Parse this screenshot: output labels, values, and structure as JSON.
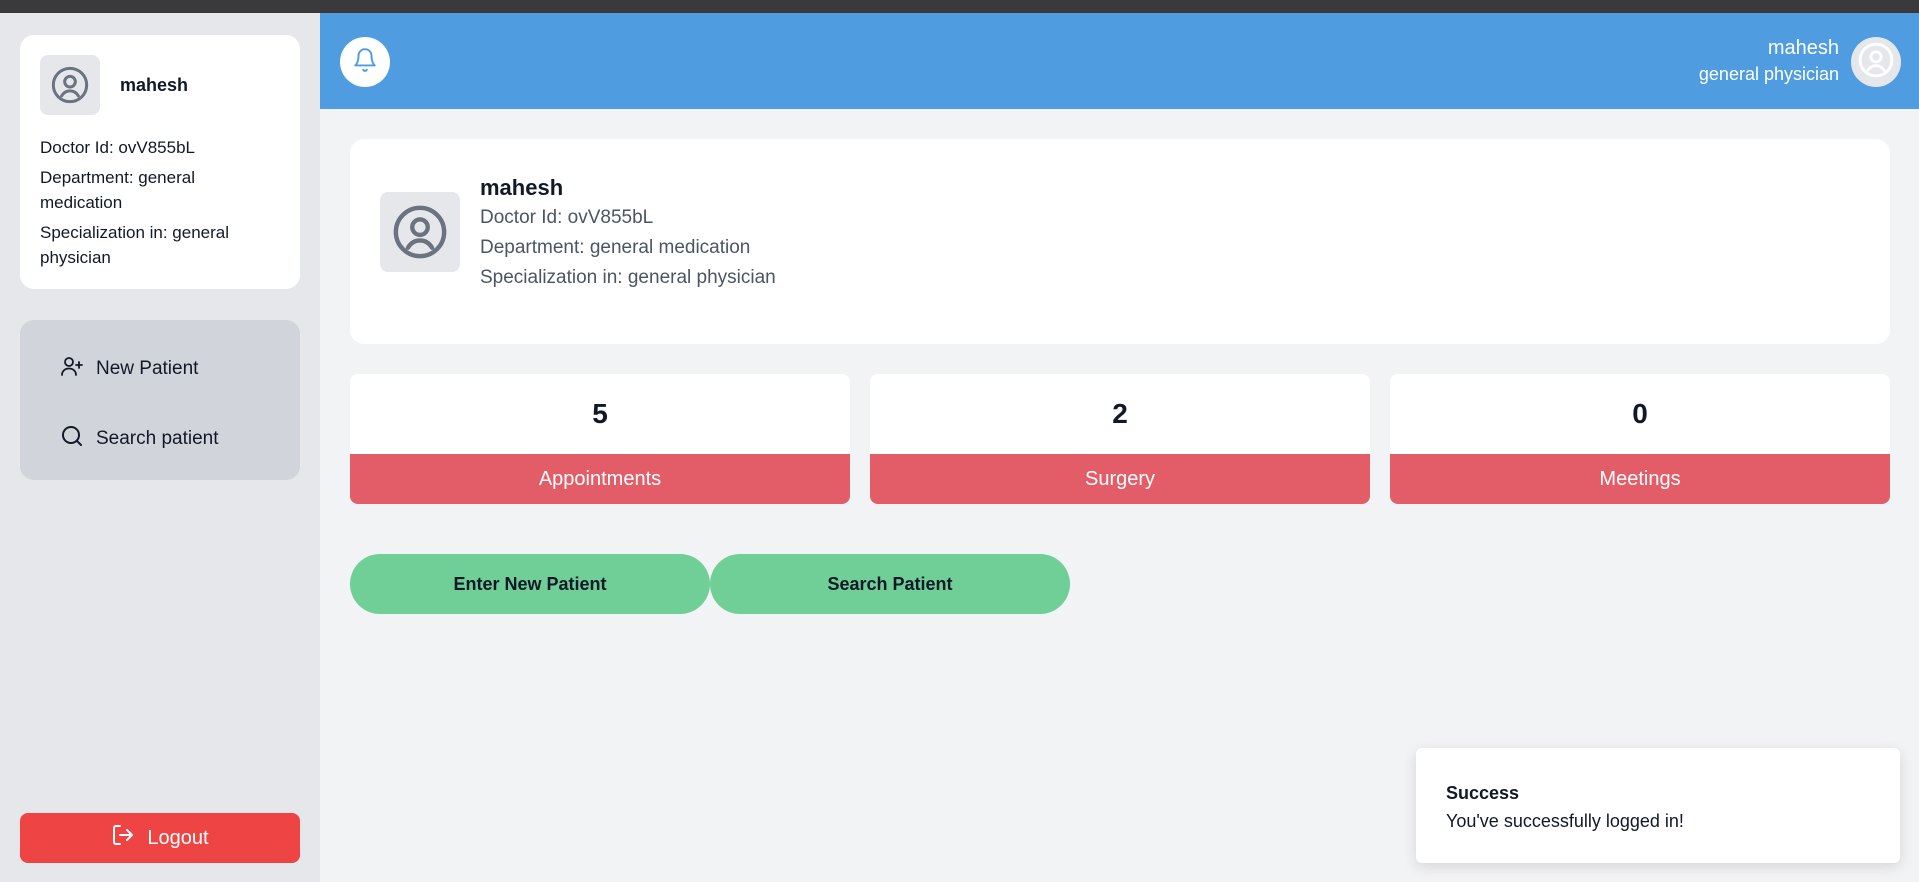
{
  "sidebar": {
    "profile": {
      "name": "mahesh",
      "doctor_id": "Doctor Id: ovV855bL",
      "department": "Department: general medication",
      "specialization": "Specialization in: general physician"
    },
    "nav": [
      {
        "label": "New Patient",
        "icon": "user-plus-icon"
      },
      {
        "label": "Search patient",
        "icon": "search-icon"
      }
    ],
    "logout_label": "Logout"
  },
  "header": {
    "user_name": "mahesh",
    "user_role": "general physician",
    "bell_icon": "bell-icon"
  },
  "main": {
    "name": "mahesh",
    "doctor_id": "Doctor Id: ovV855bL",
    "department": "Department: general medication",
    "specialization": "Specialization in: general physician"
  },
  "stats": [
    {
      "value": "5",
      "label": "Appointments"
    },
    {
      "value": "2",
      "label": "Surgery"
    },
    {
      "value": "0",
      "label": "Meetings"
    }
  ],
  "actions": {
    "enter_new_patient": "Enter New Patient",
    "search_patient": "Search Patient"
  },
  "toast": {
    "title": "Success",
    "message": "You've successfully logged in!"
  },
  "colors": {
    "header": "#4f9de0",
    "stat_label": "#e35d68",
    "action_button": "#6fcf97",
    "logout": "#ef4444"
  }
}
